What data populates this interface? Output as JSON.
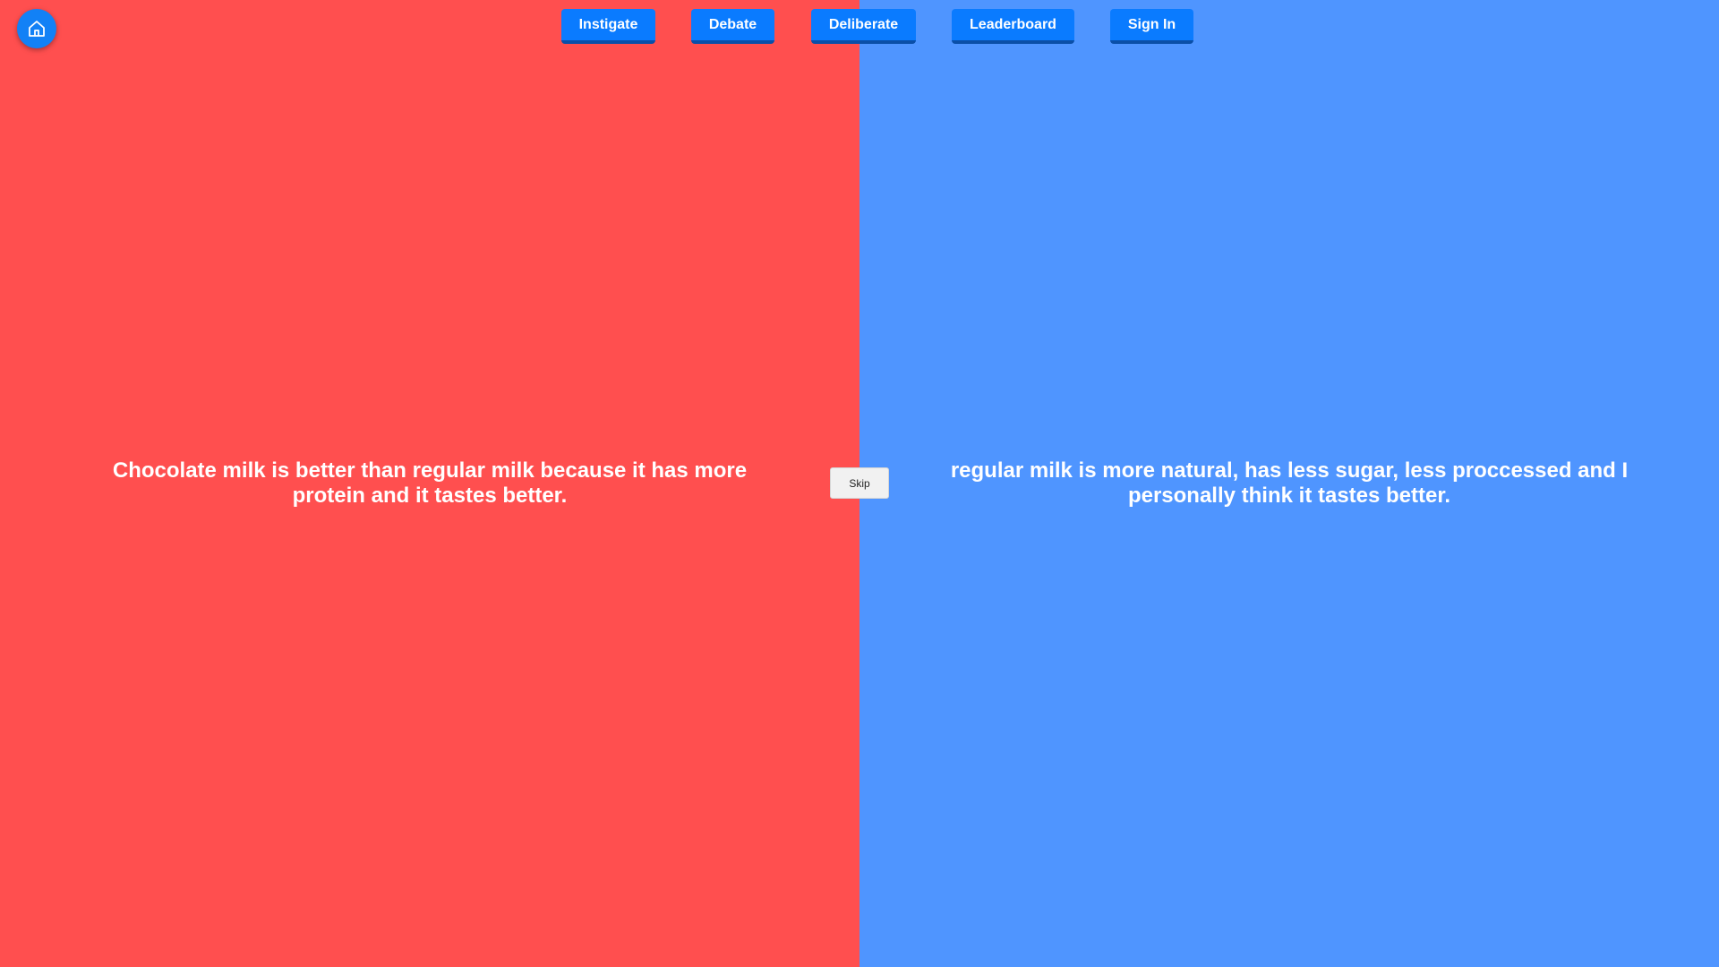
{
  "colors": {
    "left_panel": "#ff4f4f",
    "right_panel": "#4f95ff",
    "nav_button": "#0a7bff",
    "nav_button_shadow": "#0a4fa8",
    "home_button": "#1281f6",
    "text": "#ffffff"
  },
  "home": {
    "icon": "home-icon"
  },
  "nav": {
    "items": [
      {
        "label": "Instigate"
      },
      {
        "label": "Debate"
      },
      {
        "label": "Deliberate"
      },
      {
        "label": "Leaderboard"
      },
      {
        "label": "Sign In"
      }
    ]
  },
  "debate": {
    "left_argument": "Chocolate milk is better than regular milk because it has more protein and it tastes better.",
    "right_argument": "regular milk is more natural, has less sugar, less proccessed and I personally think it tastes better.",
    "skip_label": "Skip"
  }
}
